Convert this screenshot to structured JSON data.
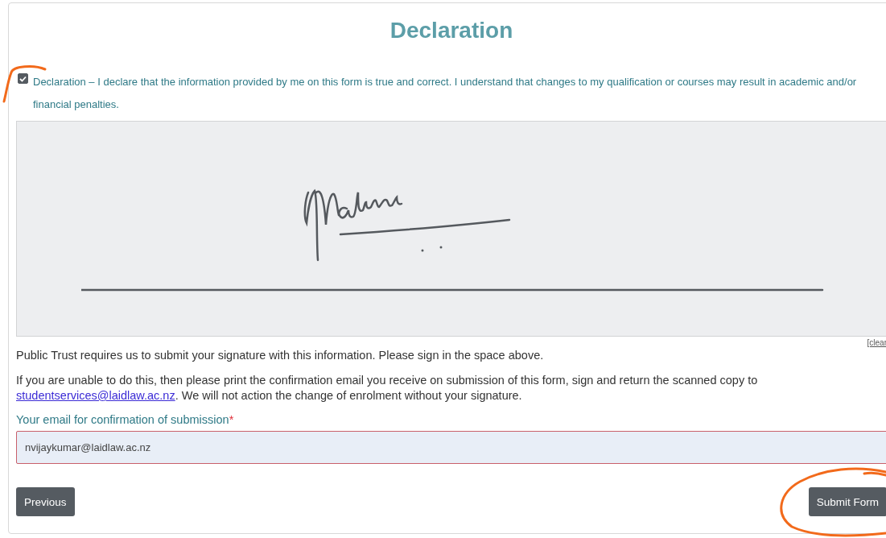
{
  "title": "Declaration",
  "declaration": {
    "checked": true,
    "text": "Declaration – I declare that the information provided by me on this form is true and correct. I understand that changes to my qualification or courses may result in academic and/or financial penalties."
  },
  "signature": {
    "clear_link": "[clear"
  },
  "notes": [
    {
      "text": "Public Trust requires us to submit your signature with this information. Please sign in the space above."
    },
    {
      "text": "If you are unable to do this, then please print the confirmation email you receive on submission of this form, sign and return the scanned copy to ",
      "link": "studentservices@laidlaw.ac.nz",
      "after": ". We will not action the change of enrolment without your signature."
    }
  ],
  "email": {
    "label": "Your email for confirmation of submission",
    "required_mark": "*",
    "value": "nvijaykumar@laidlaw.ac.nz"
  },
  "buttons": [
    {
      "label": "Previous"
    },
    {
      "label": "Submit Form"
    }
  ]
}
